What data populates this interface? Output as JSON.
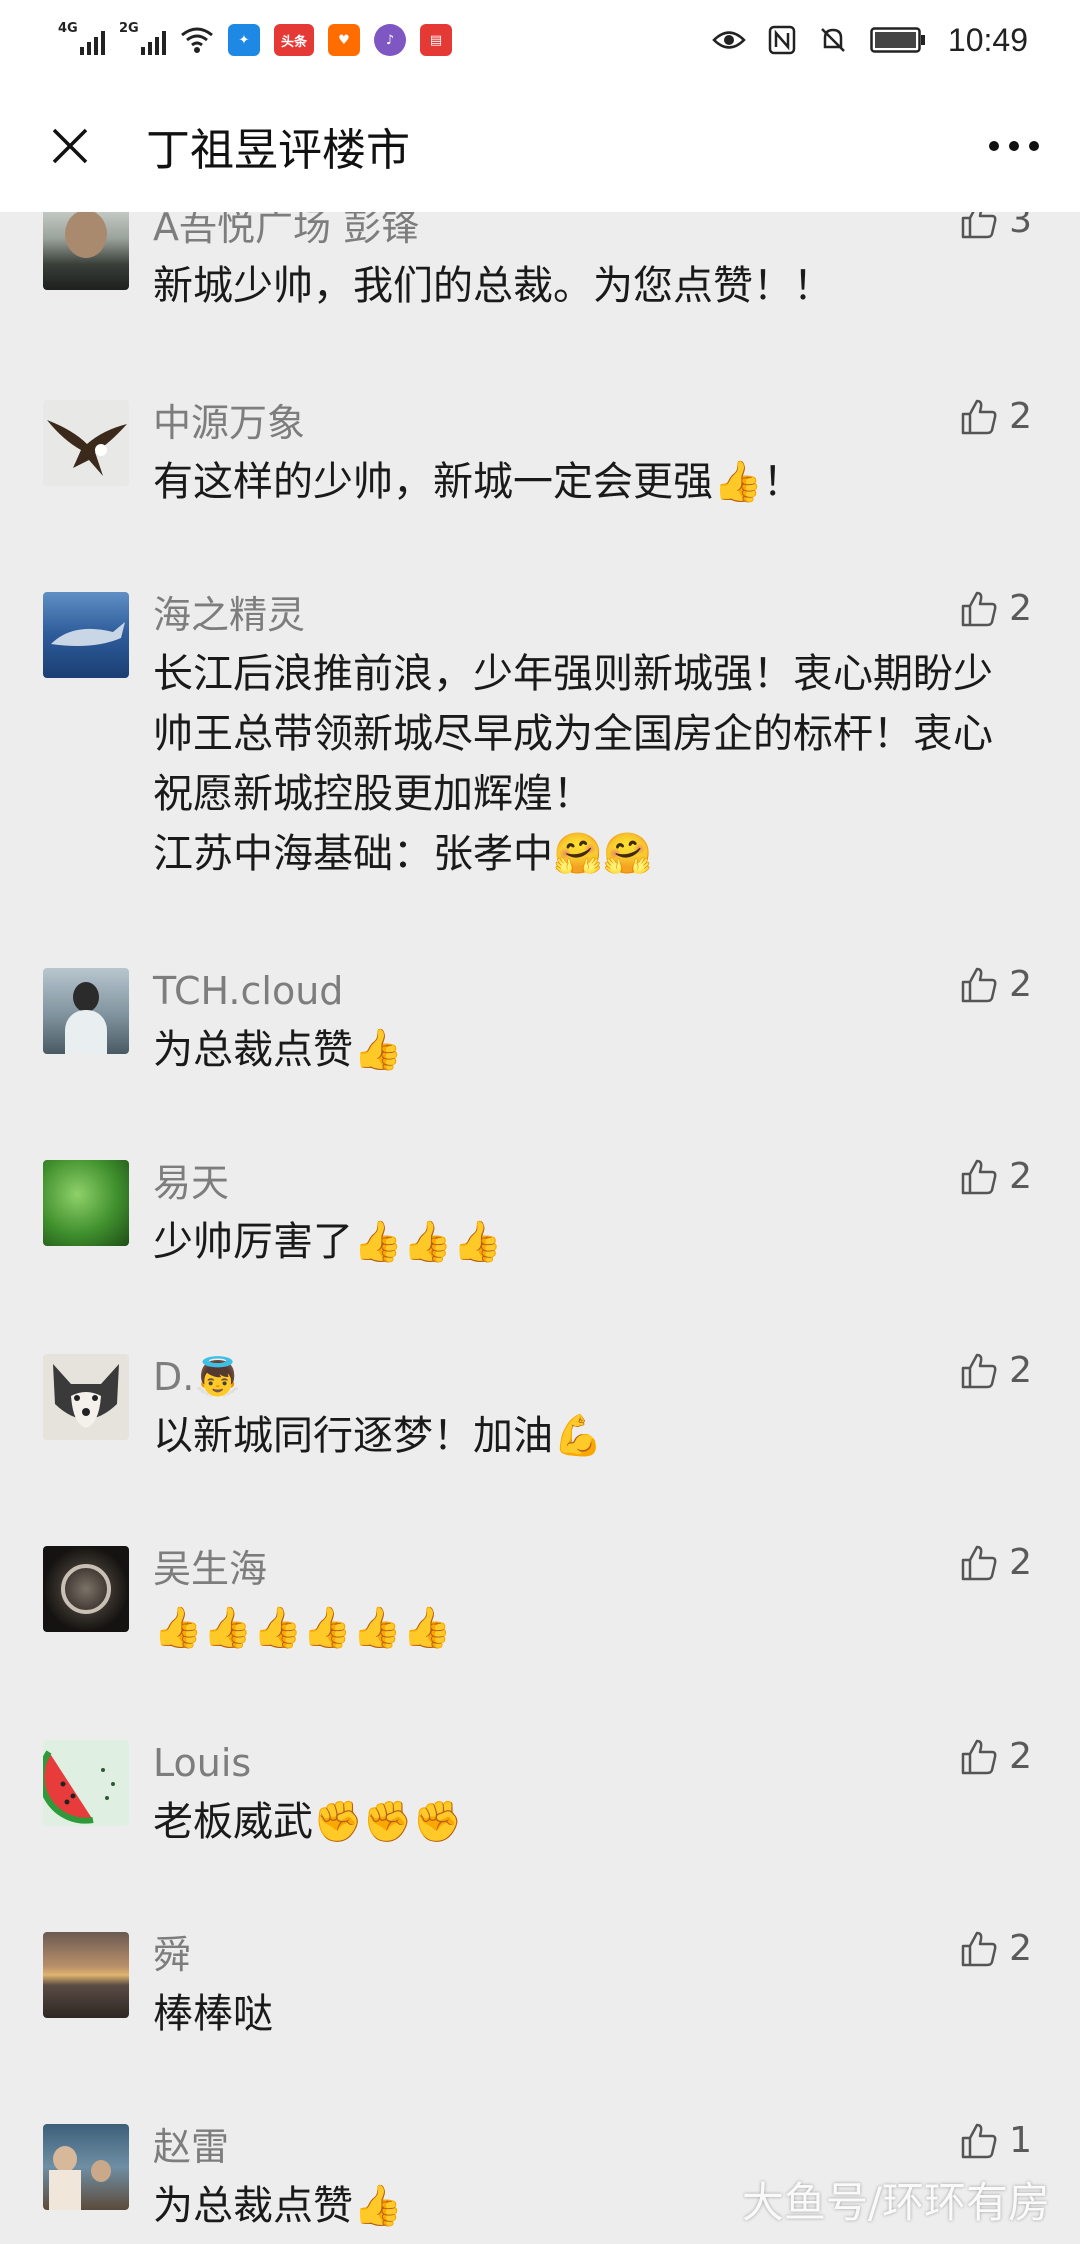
{
  "status_bar": {
    "sim1": "4G",
    "sim2": "2G",
    "app_toutiao": "头条",
    "time": "10:49"
  },
  "nav": {
    "title": "丁祖昱评楼市"
  },
  "comments": [
    {
      "author": "A吾悦广场 彭锋",
      "text": "新城少帅，我们的总裁。为您点赞！！",
      "likes": "3"
    },
    {
      "author": "中源万象",
      "text": "有这样的少帅，新城一定会更强👍！",
      "likes": "2"
    },
    {
      "author": "海之精灵",
      "text": "长江后浪推前浪，少年强则新城强！衷心期盼少帅王总带领新城尽早成为全国房企的标杆！衷心祝愿新城控股更加辉煌！",
      "text2": "江苏中海基础：张孝中🤗🤗",
      "likes": "2"
    },
    {
      "author": "TCH.cloud",
      "text": "为总裁点赞👍",
      "likes": "2"
    },
    {
      "author": "易天",
      "text": "少帅厉害了👍👍👍",
      "likes": "2"
    },
    {
      "author": "D.👼",
      "text": "以新城同行逐梦！加油💪",
      "likes": "2"
    },
    {
      "author": "吴生海",
      "text": "👍👍👍👍👍👍",
      "likes": "2"
    },
    {
      "author": "Louis",
      "text": "老板威武✊✊✊",
      "likes": "2"
    },
    {
      "author": "舜",
      "text": "棒棒哒",
      "likes": "2"
    },
    {
      "author": "赵雷",
      "text": "为总裁点赞👍",
      "likes": "1"
    }
  ],
  "watermark": "大鱼号/环环有房"
}
